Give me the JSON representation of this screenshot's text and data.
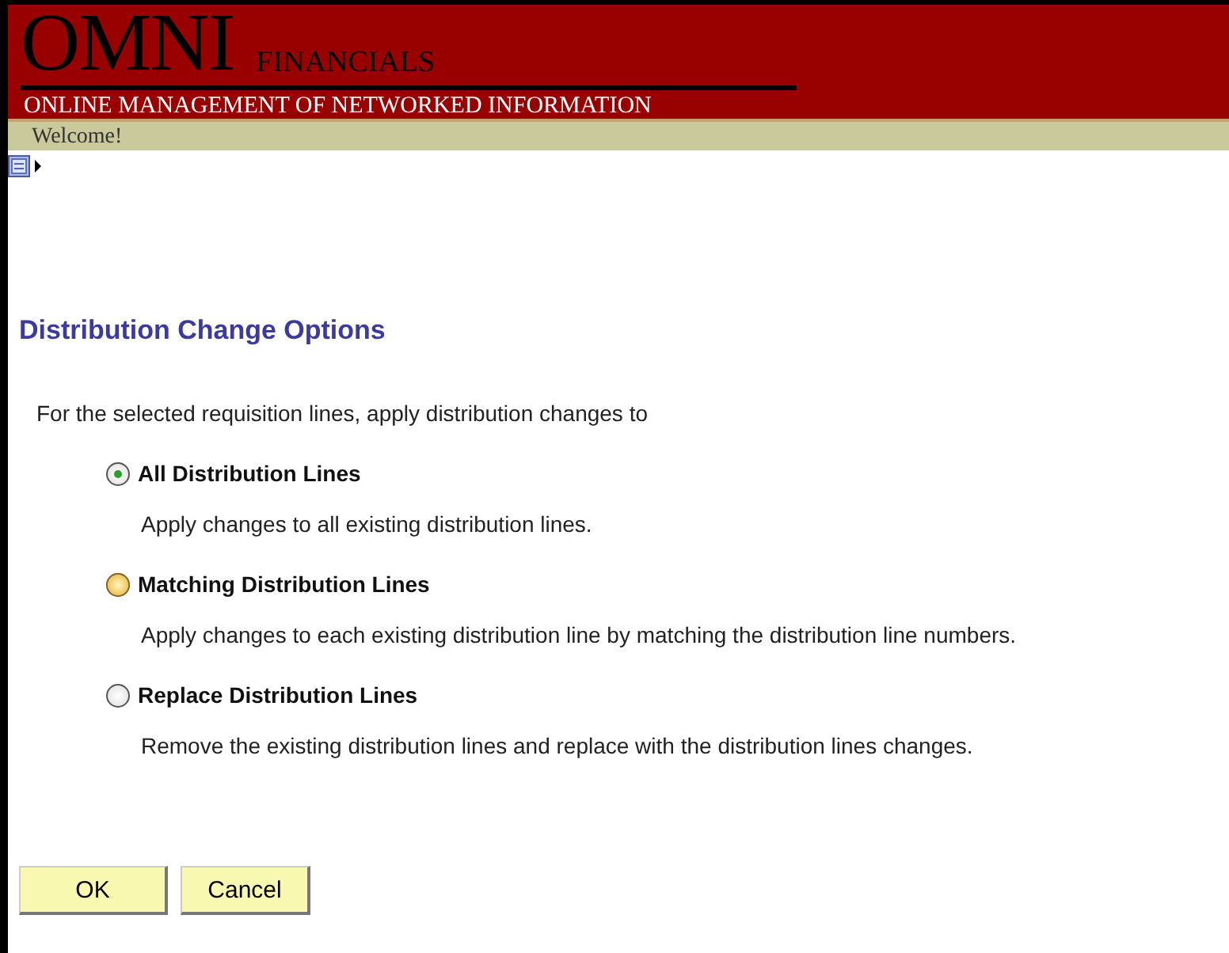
{
  "header": {
    "logo": "OMNI",
    "logo_suffix": "FINANCIALS",
    "tagline": "ONLINE MANAGEMENT OF NETWORKED INFORMATION"
  },
  "welcome": "Welcome!",
  "title": "Distribution Change Options",
  "intro": "For the selected requisition lines, apply distribution changes to",
  "options": [
    {
      "label": "All Distribution Lines",
      "description": "Apply changes to all existing distribution lines.",
      "selected": true,
      "hovered": false
    },
    {
      "label": "Matching Distribution Lines",
      "description": "Apply changes to each existing distribution line by matching the distribution line numbers.",
      "selected": false,
      "hovered": true
    },
    {
      "label": "Replace Distribution Lines",
      "description": "Remove the existing distribution lines and replace with the distribution lines changes.",
      "selected": false,
      "hovered": false
    }
  ],
  "buttons": [
    "OK",
    "Cancel"
  ]
}
